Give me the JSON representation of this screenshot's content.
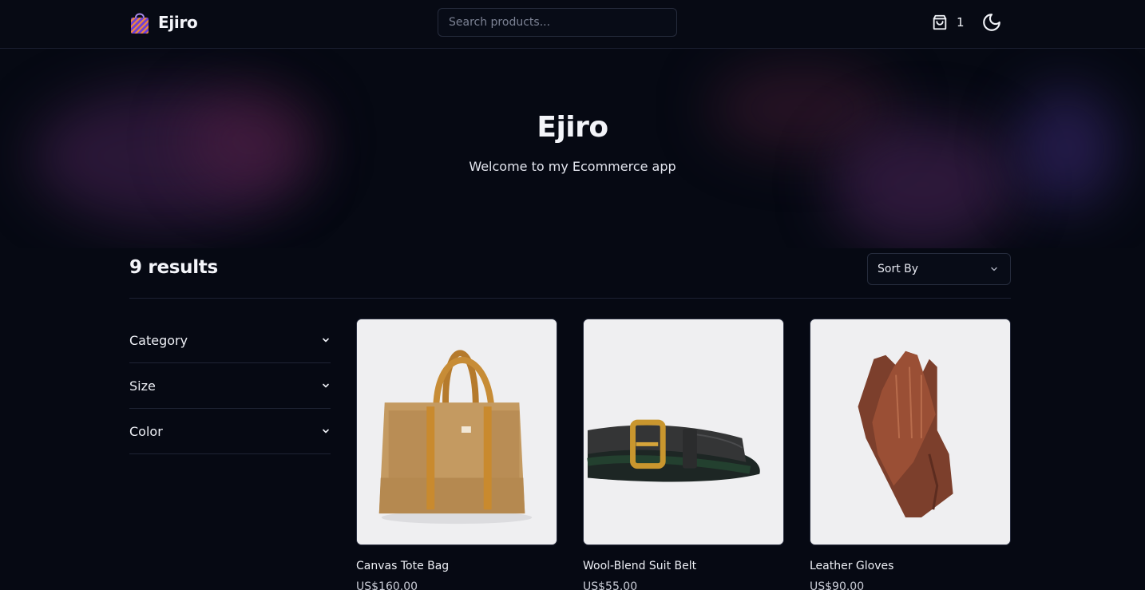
{
  "header": {
    "brand": "Ejiro",
    "search_placeholder": "Search products...",
    "cart_count": "1"
  },
  "hero": {
    "title": "Ejiro",
    "subtitle": "Welcome to my Ecommerce app"
  },
  "results": {
    "count_label": "9 results",
    "sort_label": "Sort By"
  },
  "filters": [
    {
      "label": "Category"
    },
    {
      "label": "Size"
    },
    {
      "label": "Color"
    }
  ],
  "products": [
    {
      "name": "Canvas Tote Bag",
      "price": "US$160.00"
    },
    {
      "name": "Wool-Blend Suit Belt",
      "price": "US$55.00"
    },
    {
      "name": "Leather Gloves",
      "price": "US$90.00"
    }
  ]
}
